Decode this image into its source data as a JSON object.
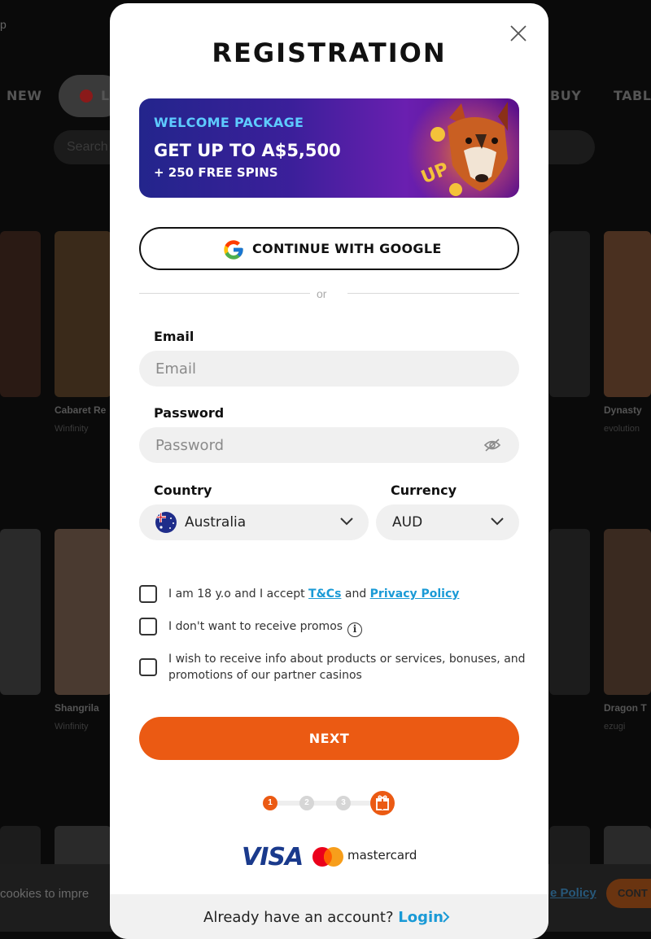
{
  "background": {
    "tabs": [
      "NEW",
      "L",
      "BUY",
      "TABL"
    ],
    "search_placeholder": "Search",
    "cards": [
      {
        "title": "Cabaret Re",
        "provider": "Winfinity"
      },
      {
        "title": "Dynasty",
        "provider": "evolution"
      },
      {
        "title": "Shangrila",
        "provider": "Winfinity"
      },
      {
        "title": "Dragon T",
        "provider": "ezugi"
      }
    ],
    "cookie_text": "cookies to impre",
    "cookie_policy": "e Policy",
    "cookie_button": "CONT"
  },
  "modal": {
    "title": "REGISTRATION",
    "banner": {
      "line1": "WELCOME PACKAGE",
      "line2": "GET UP TO A$5,500",
      "line3": "+ 250 FREE SPINS",
      "badge": "UP"
    },
    "google_button": "CONTINUE WITH GOOGLE",
    "or_text": "or",
    "email": {
      "label": "Email",
      "placeholder": "Email"
    },
    "password": {
      "label": "Password",
      "placeholder": "Password"
    },
    "country": {
      "label": "Country",
      "value": "Australia"
    },
    "currency": {
      "label": "Currency",
      "value": "AUD"
    },
    "checkboxes": {
      "terms_prefix": "I am 18 y.o and I accept ",
      "terms_link": "T&Cs",
      "terms_and": " and ",
      "privacy_link": "Privacy Policy",
      "promos": "I don't want to receive promos",
      "partners": "I wish to receive info about products or services, bonuses, and promotions of our partner casinos"
    },
    "next_button": "NEXT",
    "steps": [
      "1",
      "2",
      "3"
    ],
    "payments": {
      "visa": "VISA",
      "mastercard": "mastercard"
    },
    "footer": {
      "text": "Already have an account?",
      "login": "Login"
    }
  },
  "colors": {
    "accent": "#eb5a13",
    "link": "#1a9ad6",
    "field_bg": "#f0f0f0"
  }
}
